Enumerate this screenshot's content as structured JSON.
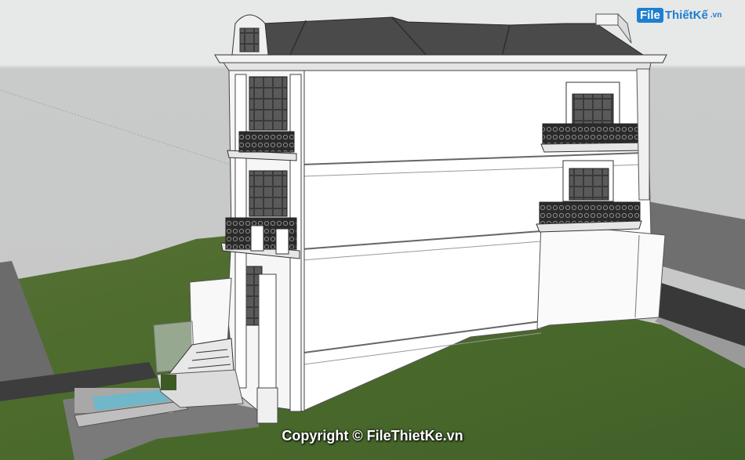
{
  "watermark": {
    "logo_box": "File",
    "logo_text": "ThiếtKế",
    "logo_domain": ".vn",
    "copyright": "Copyright © FileThietKe.vn"
  },
  "colors": {
    "sky": "#cfd0d0",
    "grass": "#4b6a2c",
    "road": "#5f5f5f",
    "wall": "#ffffff",
    "roof": "#4a4a4a",
    "brand": "#1e7fd0"
  }
}
